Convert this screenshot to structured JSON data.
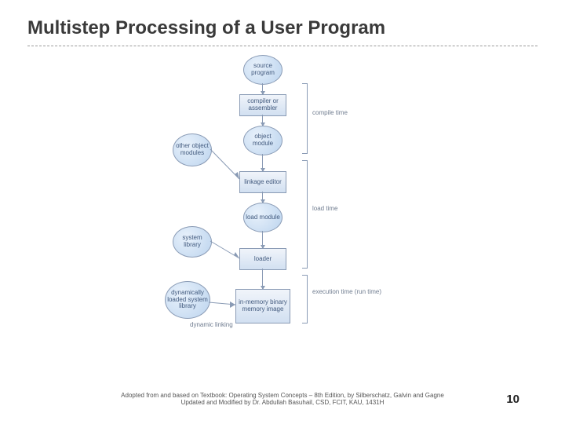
{
  "title": "Multistep Processing of a User Program",
  "nodes": {
    "source": "source\nprogram",
    "compiler": "compiler or\nassembler",
    "object": "object\nmodule",
    "other_obj": "other\nobject\nmodules",
    "linker": "linkage\neditor",
    "load_module": "load\nmodule",
    "syslib": "system\nlibrary",
    "loader": "loader",
    "dynlib": "dynamically\nloaded\nsystem\nlibrary",
    "mem_image": "in-memory\nbinary\nmemory\nimage"
  },
  "phases": {
    "compile": "compile\ntime",
    "load": "load\ntime",
    "exec": "execution\ntime (run\ntime)"
  },
  "labels": {
    "dynamic_linking": "dynamic\nlinking"
  },
  "footer": {
    "line1": "Adopted from and based on Textbook: Operating System Concepts – 8th Edition, by Silberschatz, Galvin and Gagne",
    "line2": "Updated and Modified by Dr. Abdullah Basuhail, CSD, FCIT, KAU, 1431H"
  },
  "page_number": "10"
}
